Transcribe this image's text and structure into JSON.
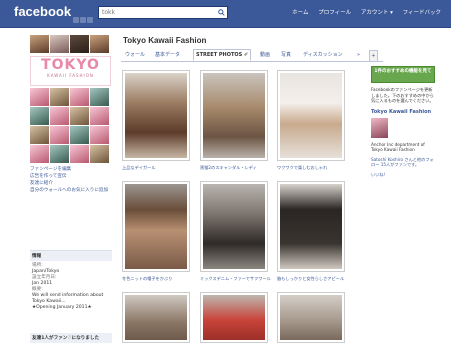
{
  "topbar": {
    "logo": "facebook",
    "search_value": "tokk",
    "nav": [
      "ホーム",
      "プロフィール",
      "アカウント ▾",
      "フィードバック"
    ]
  },
  "page": {
    "title": "Tokyo Kawaii Fashion",
    "tabs": [
      "ウォール",
      "基本データ",
      "STREET PHOTOS ✐",
      "動画",
      "写真",
      "ディスカッション",
      "»",
      "+"
    ]
  },
  "sidebar": {
    "logo_text": "TOKYO",
    "logo_sub": "KAWAII FASHION",
    "links": [
      "ファンページを編集",
      "広告を作って宣伝",
      "友達に紹介",
      "自分のウォールへのお気に入りに追加"
    ],
    "info": {
      "heading": "情報",
      "location_label": "場所:",
      "location": "Japan/Tokyo",
      "founded_label": "設立年月日:",
      "founded": "Jan 2011",
      "about_label": "概要:",
      "about": "We will send information about Tokyo Kawaii...",
      "opening": "★Opening January 2011★"
    },
    "more_heading": "友達1人がファン♡になりました"
  },
  "photos": [
    {
      "caption": "上品なデイガール"
    },
    {
      "caption": "黒猫2のスキャンダル・レディ"
    },
    {
      "caption": "ワクワクで楽しむおしゃれ"
    },
    {
      "caption": "冬色ニットの帽子をかぶり"
    },
    {
      "caption": "ミックスデニム・ファーでサフワール"
    },
    {
      "caption": "脇もしっかりと女性らしさアピール"
    },
    {
      "caption": ""
    },
    {
      "caption": ""
    },
    {
      "caption": ""
    }
  ],
  "right": {
    "green_button": "1件のおすすめの機能を見て",
    "intro": "Facebookのファンページを更新しました。下のおすすめの中から気に入るものを選んでください。",
    "page_title": "Tokyo Kawaii Fashion",
    "desc": "Anchor Inc department of Tokyo Kawaii Fashion",
    "fans_text": "Satoshi Koshiro さんと他のフォロー 15人がファンです。",
    "like": "いいね!"
  },
  "colors": {
    "brand": "#3b5998",
    "accent_pink": "#e889a8",
    "green": "#69a74e"
  }
}
